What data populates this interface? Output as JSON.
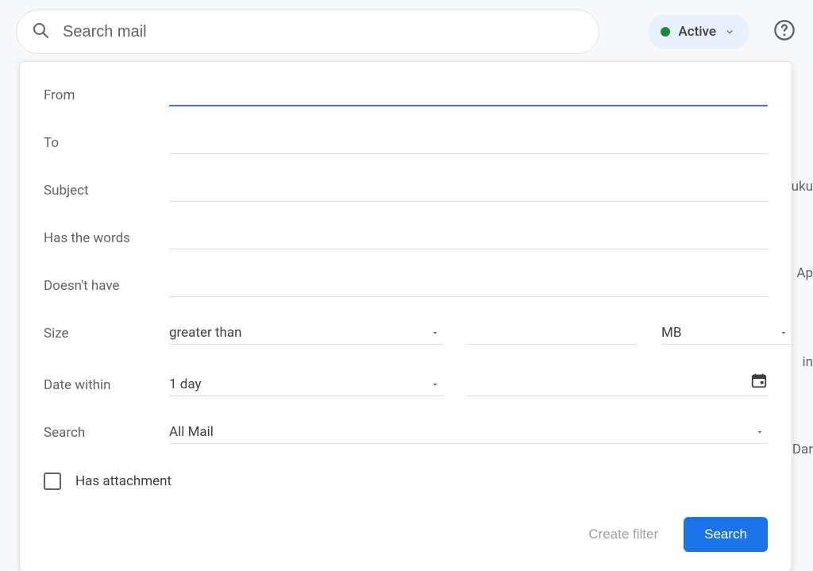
{
  "search": {
    "placeholder": "Search mail"
  },
  "status": {
    "label": "Active"
  },
  "filter": {
    "labels": {
      "from": "From",
      "to": "To",
      "subject": "Subject",
      "has_words": "Has the words",
      "doesnt_have": "Doesn't have",
      "size": "Size",
      "date_within": "Date within",
      "search_in": "Search",
      "has_attachment": "Has attachment"
    },
    "values": {
      "from": "",
      "to": "",
      "subject": "",
      "has_words": "",
      "doesnt_have": "",
      "size_op": "greater than",
      "size_value": "",
      "size_unit": "MB",
      "date_within": "1 day",
      "date_value": "",
      "search_in": "All Mail",
      "has_attachment_checked": false
    },
    "actions": {
      "create_filter": "Create filter",
      "search": "Search"
    }
  },
  "background_hints": {
    "r1": "uku",
    "r2": "Ap",
    "r3": "in",
    "r4": "Dar"
  }
}
